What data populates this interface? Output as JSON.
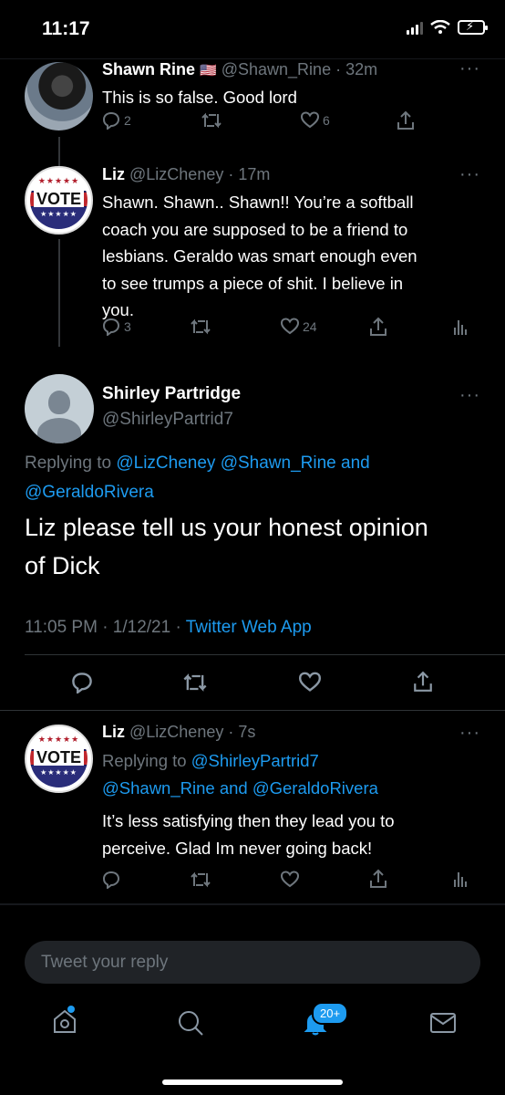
{
  "status_bar": {
    "time": "11:17"
  },
  "tweets": [
    {
      "name": "Shawn Rine",
      "flag": "🇺🇸",
      "handle": "@Shawn_Rine",
      "time": "32m",
      "text": "This is so false. Good lord",
      "replies": "2",
      "likes": "6"
    },
    {
      "name": "Liz",
      "handle": "@LizCheney",
      "time": "17m",
      "text_lines": [
        "Shawn. Shawn.. Shawn!! You’re a softball",
        "coach you are supposed to be a friend to",
        "lesbians. Geraldo was smart enough even",
        "to see trumps a piece of shit. I believe in",
        "you."
      ],
      "replies": "3",
      "likes": "24"
    }
  ],
  "avatar_vote": {
    "stars": "★★★★★",
    "word": "VOTE"
  },
  "focus": {
    "name": "Shirley Partridge",
    "handle": "@ShirleyPartrid7",
    "replying_prefix": "Replying to",
    "reply_to_1": "@LizCheney",
    "reply_to_2": "@Shawn_Rine",
    "and": "and",
    "reply_to_3": "@GeraldoRivera",
    "text_line1": "Liz please tell us your honest opinion",
    "text_line2": "of Dick",
    "timestamp": "11:05 PM · 1/12/21 · ",
    "source": "Twitter Web App"
  },
  "reply": {
    "name": "Liz",
    "handle": "@LizCheney",
    "time": "7s",
    "replying_prefix": "Replying to",
    "reply_to_1": "@ShirleyPartrid7",
    "reply_to_2": "@Shawn_Rine",
    "and": "and",
    "reply_to_3": "@GeraldoRivera",
    "text_line1": "It’s less satisfying then they lead you to",
    "text_line2": "perceive. Glad Im never going back!"
  },
  "compose": {
    "placeholder": "Tweet your reply"
  },
  "nav": {
    "notifications_badge": "20+"
  },
  "colors": {
    "accent": "#1d9bf0",
    "background": "#000000",
    "muted": "#6e767d"
  }
}
